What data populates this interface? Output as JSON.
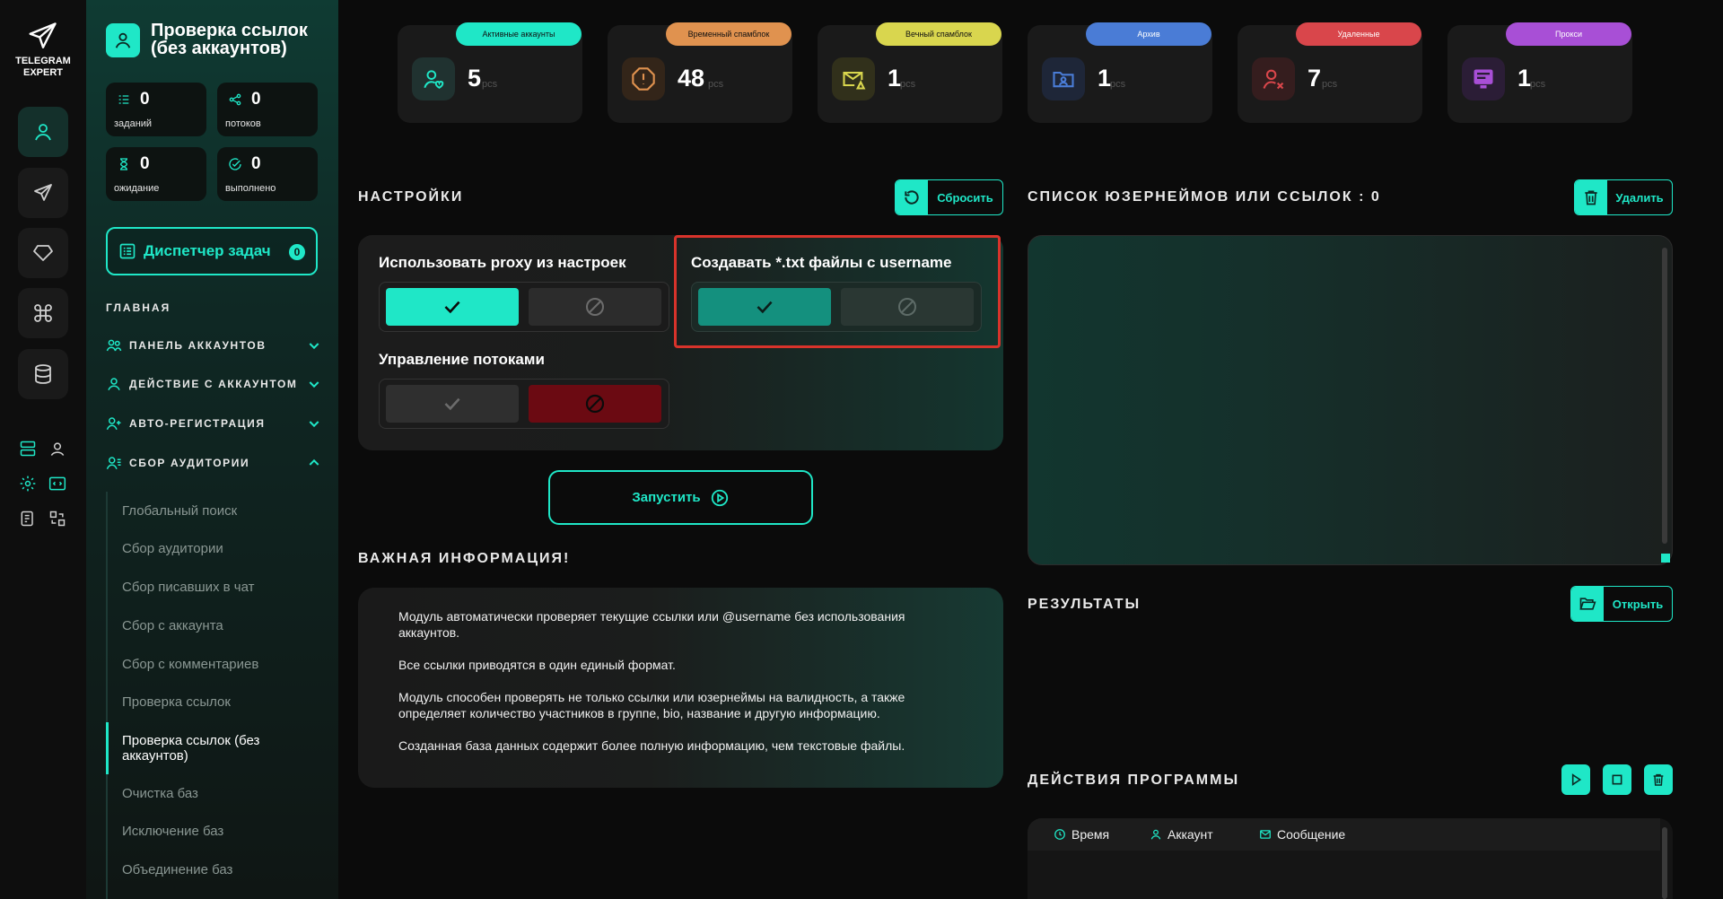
{
  "app": {
    "logo_line1": "TELEGRAM",
    "logo_line2": "EXPERT"
  },
  "colors": {
    "accent": "#1fe7c7",
    "bg": "#0b0b0b",
    "danger": "#6b0a12",
    "highlight": "#d8332b"
  },
  "module": {
    "title": "Проверка ссылок (без аккаунтов)",
    "stats": [
      {
        "value": "0",
        "label": "заданий",
        "icon": "tasks-icon"
      },
      {
        "value": "0",
        "label": "потоков",
        "icon": "share-icon"
      },
      {
        "value": "0",
        "label": "ожидание",
        "icon": "hourglass-icon"
      },
      {
        "value": "0",
        "label": "выполнено",
        "icon": "check-circle-icon"
      }
    ]
  },
  "dispatcher": {
    "label": "Диспетчер задач",
    "count": "0"
  },
  "nav": {
    "section": "ГЛАВНАЯ",
    "items": [
      {
        "label": "ПАНЕЛЬ АККАУНТОВ"
      },
      {
        "label": "ДЕЙСТВИЕ С АККАУНТОМ"
      },
      {
        "label": "АВТО-РЕГИСТРАЦИЯ"
      },
      {
        "label": "СБОР АУДИТОРИИ"
      }
    ],
    "sub_items": [
      "Глобальный поиск",
      "Сбор аудитории",
      "Сбор писавших в чат",
      "Сбор с аккаунта",
      "Сбор с комментариев",
      "Проверка ссылок",
      "Проверка ссылок (без аккаунтов)",
      "Очистка баз",
      "Исключение баз",
      "Объединение баз"
    ]
  },
  "cards": [
    {
      "tag": "Активные аккаунты",
      "value": "5",
      "unit": "pcs",
      "color": "#1fe7c7",
      "icon": "user-heart-icon"
    },
    {
      "tag": "Временный спамблок",
      "value": "48",
      "unit": "pcs",
      "color": "#e0924f",
      "icon": "alert-octagon-icon"
    },
    {
      "tag": "Вечный спамблок",
      "value": "1",
      "unit": "pcs",
      "color": "#d9d64e",
      "icon": "mail-warning-icon"
    },
    {
      "tag": "Архив",
      "value": "1",
      "unit": "pcs",
      "color": "#4a7cd6",
      "icon": "folder-user-icon"
    },
    {
      "tag": "Удаленные",
      "value": "7",
      "unit": "pcs",
      "color": "#d9464b",
      "icon": "user-x-icon"
    },
    {
      "tag": "Прокси",
      "value": "1",
      "unit": "pcs",
      "color": "#a84fd6",
      "icon": "proxy-icon"
    }
  ],
  "settings": {
    "heading": "НАСТРОЙКИ",
    "reset_label": "Сбросить",
    "use_proxy_label": "Использовать proxy из настроек",
    "create_txt_label": "Создавать *.txt файлы с username",
    "threads_label": "Управление потоками"
  },
  "run_label": "Запустить",
  "info": {
    "heading": "ВАЖНАЯ ИНФОРМАЦИЯ!",
    "p1": "Модуль автоматически проверяет текущие ссылки или @username без использования аккаунтов.",
    "p2": "Все ссылки приводятся в один единый формат.",
    "p3": "Модуль способен проверять не только ссылки или юзернеймы на валидность, а также определяет количество участников в группе, bio, название и другую информацию.",
    "p4": "Созданная база данных содержит более полную информацию, чем текстовые файлы."
  },
  "list": {
    "heading": "СПИСОК ЮЗЕРНЕЙМОВ ИЛИ ССЫЛОК : 0",
    "delete_label": "Удалить"
  },
  "results": {
    "heading": "РЕЗУЛЬТАТЫ",
    "open_label": "Открыть"
  },
  "actions": {
    "heading": "ДЕЙСТВИЯ ПРОГРАММЫ",
    "columns": {
      "time": "Время",
      "account": "Аккаунт",
      "message": "Сообщение"
    }
  }
}
